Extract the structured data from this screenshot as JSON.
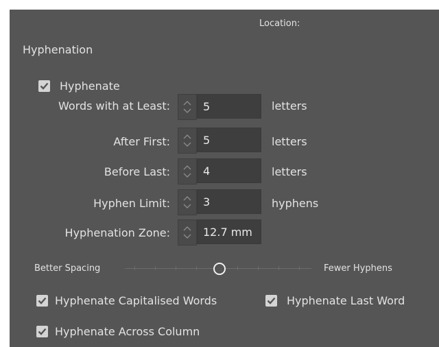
{
  "header": {
    "location_label": "Location:"
  },
  "section_title": "Hyphenation",
  "hyphenate": {
    "label": "Hyphenate",
    "checked": true
  },
  "fields": [
    {
      "label": "Words with at Least:",
      "value": "5",
      "unit": "letters"
    },
    {
      "label": "After First:",
      "value": "5",
      "unit": "letters"
    },
    {
      "label": "Before Last:",
      "value": "4",
      "unit": "letters"
    },
    {
      "label": "Hyphen Limit:",
      "value": "3",
      "unit": "hyphens"
    },
    {
      "label": "Hyphenation Zone:",
      "value": "12.7 mm",
      "unit": ""
    }
  ],
  "slider": {
    "left_label": "Better Spacing",
    "right_label": "Fewer Hyphens",
    "position_fraction": 0.5
  },
  "options": {
    "capitalised": {
      "label": "Hyphenate Capitalised Words",
      "checked": true
    },
    "last_word": {
      "label": "Hyphenate Last Word",
      "checked": true
    },
    "across_column": {
      "label": "Hyphenate Across Column",
      "checked": true
    }
  },
  "colors": {
    "panel_bg": "#555555",
    "text": "#e3e3e3",
    "field_bg": "#3e3e3e",
    "checkbox": "#d4d4d4"
  },
  "icons": {
    "spinner": "up-down-spinner-icon",
    "checkbox": "checkmark-icon",
    "slider_knob": "slider-knob-icon"
  }
}
